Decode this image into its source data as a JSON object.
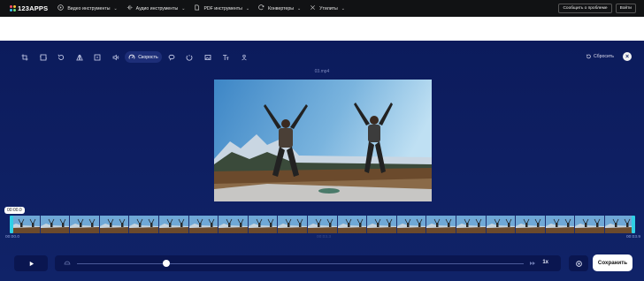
{
  "brand": {
    "name": "123APPS"
  },
  "nav": [
    {
      "label": "Видео инструменты",
      "icon": "video-icon"
    },
    {
      "label": "Аудио инструменты",
      "icon": "audio-icon"
    },
    {
      "label": "PDF инструменты",
      "icon": "pdf-icon"
    },
    {
      "label": "Конвертеры",
      "icon": "convert-icon"
    },
    {
      "label": "Утилиты",
      "icon": "utilities-icon"
    }
  ],
  "header": {
    "report_label": "Сообщить о проблеме",
    "login_label": "Войти"
  },
  "toolbar": {
    "tools": [
      "crop-icon",
      "trim-icon",
      "rotate-icon",
      "flip-icon",
      "resize-icon",
      "volume-icon",
      "speed-icon",
      "loop-icon",
      "stabilize-icon",
      "image-icon",
      "text-icon",
      "record-icon"
    ],
    "active_label": "Скорость",
    "reset_label": "Сбросить"
  },
  "file": {
    "name": "03.mp4"
  },
  "timeline": {
    "current_pill": "00:00.0",
    "start": "00:00.0",
    "middle": "00:03.3",
    "end": "00:03.9"
  },
  "player": {
    "progress_fraction": 0.2,
    "speed_value": "1x",
    "save_label": "Сохранить"
  }
}
